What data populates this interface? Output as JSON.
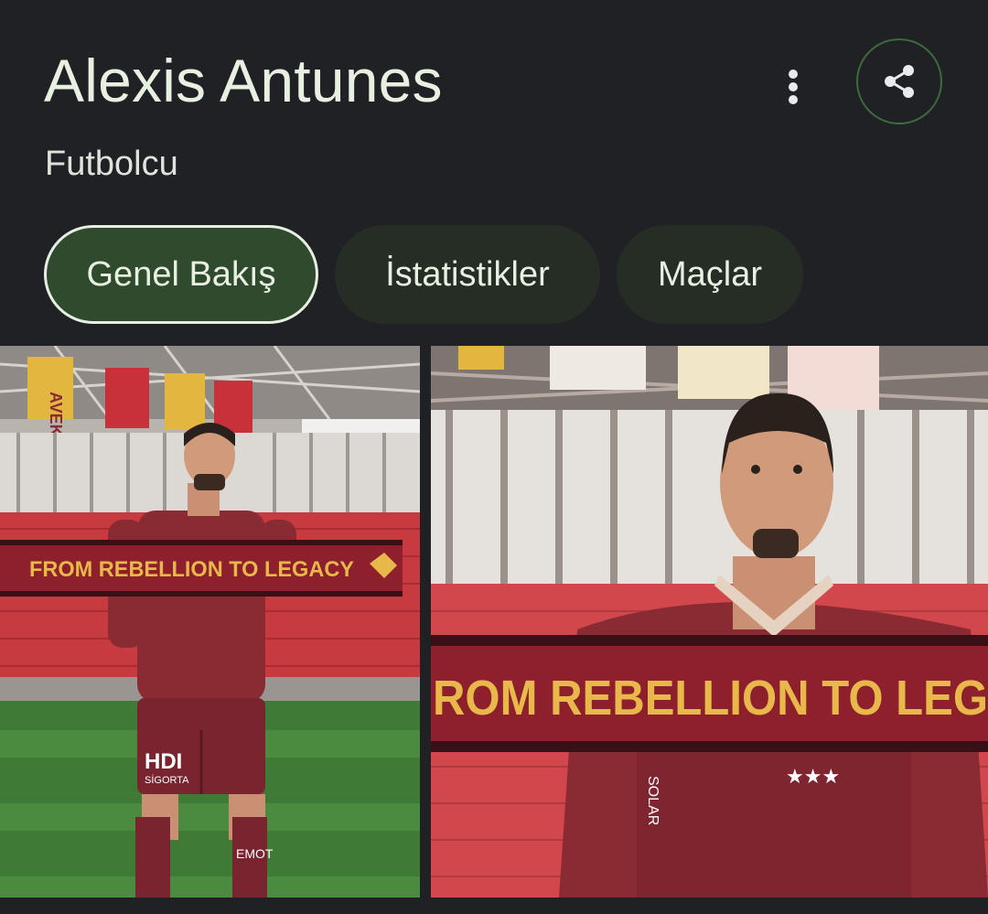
{
  "header": {
    "title": "Alexis Antunes",
    "subtitle": "Futbolcu"
  },
  "actions": {
    "more_icon": "more-vert-icon",
    "share_icon": "share-icon"
  },
  "tabs": [
    {
      "label": "Genel Bakış",
      "active": true
    },
    {
      "label": "İstatistikler",
      "active": false
    },
    {
      "label": "Maçlar",
      "active": false
    }
  ],
  "images": [
    {
      "scarf_text": "FROM REBELLION TO LEGACY",
      "shorts_sponsor": "HDI",
      "shorts_sponsor_sub": "SİGORTA",
      "banner_text": "AVEK",
      "sock_text": "EMOT"
    },
    {
      "scarf_text": "ROM REBELLION TO LEG",
      "shirt_side_text": "SOLAR"
    }
  ],
  "colors": {
    "background": "#202124",
    "chip_active_bg": "#2f4a2d",
    "chip_bg": "#262d25",
    "share_border": "#3f6a3f",
    "jersey": "#8a2a33",
    "scarf_text": "#e8b84a"
  }
}
